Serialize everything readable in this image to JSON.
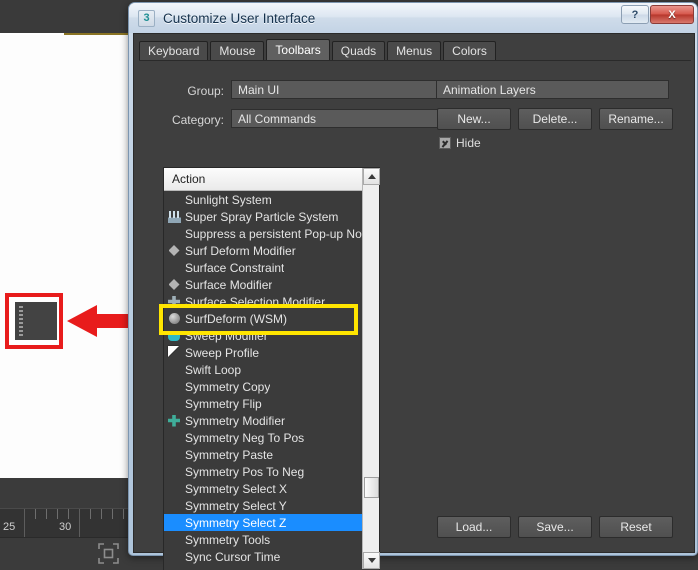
{
  "background_app": {
    "name": "3ds Max viewport",
    "timeline": {
      "labels": [
        {
          "text": "25",
          "x": 6
        },
        {
          "text": "30",
          "x": 62
        }
      ]
    },
    "select_icon": "select-object-icon"
  },
  "annotations": {
    "red_box": {
      "name": "red-highlight-box",
      "color": "#e81c1c"
    },
    "red_arrow": {
      "name": "red-arrow-pointer",
      "color": "#e81c1c"
    },
    "yellow_box": {
      "name": "yellow-highlight-box",
      "color": "#ffe500"
    }
  },
  "dialog": {
    "title": "Customize User Interface",
    "icon": "3ds-max-logo-icon",
    "window_buttons": {
      "help": "?",
      "close": "X"
    },
    "tabs": [
      {
        "label": "Keyboard",
        "active": false
      },
      {
        "label": "Mouse",
        "active": false
      },
      {
        "label": "Toolbars",
        "active": true
      },
      {
        "label": "Quads",
        "active": false
      },
      {
        "label": "Menus",
        "active": false
      },
      {
        "label": "Colors",
        "active": false
      }
    ],
    "fields": {
      "group_label": "Group:",
      "group_value": "Main UI",
      "category_label": "Category:",
      "category_value": "All Commands"
    },
    "list": {
      "header": "Action",
      "items": [
        {
          "label": "Sunlight System",
          "icon": "none",
          "selected": false
        },
        {
          "label": "Super Spray Particle System",
          "icon": "spray",
          "selected": false
        },
        {
          "label": "Suppress a persistent Pop-up Note",
          "icon": "none",
          "selected": false
        },
        {
          "label": "Surf Deform Modifier",
          "icon": "diamond",
          "selected": false
        },
        {
          "label": "Surface Constraint",
          "icon": "none",
          "selected": false
        },
        {
          "label": "Surface Modifier",
          "icon": "diamond",
          "selected": false
        },
        {
          "label": "Surface Selection Modifier",
          "icon": "cross-gray",
          "selected": false
        },
        {
          "label": "SurfDeform (WSM)",
          "icon": "sphere",
          "selected": false
        },
        {
          "label": "Sweep Modifier",
          "icon": "teal",
          "selected": false
        },
        {
          "label": "Sweep Profile",
          "icon": "cursor",
          "selected": false
        },
        {
          "label": "Swift Loop",
          "icon": "none",
          "selected": false
        },
        {
          "label": "Symmetry Copy",
          "icon": "none",
          "selected": false
        },
        {
          "label": "Symmetry Flip",
          "icon": "none",
          "selected": false
        },
        {
          "label": "Symmetry Modifier",
          "icon": "cross",
          "selected": false
        },
        {
          "label": "Symmetry Neg To Pos",
          "icon": "none",
          "selected": false
        },
        {
          "label": "Symmetry Paste",
          "icon": "none",
          "selected": false
        },
        {
          "label": "Symmetry Pos To Neg",
          "icon": "none",
          "selected": false
        },
        {
          "label": "Symmetry Select X",
          "icon": "none",
          "selected": false
        },
        {
          "label": "Symmetry Select Y",
          "icon": "none",
          "selected": false
        },
        {
          "label": "Symmetry Select Z",
          "icon": "none",
          "selected": true
        },
        {
          "label": "Symmetry Tools",
          "icon": "none",
          "selected": false
        },
        {
          "label": "Sync Cursor Time",
          "icon": "none",
          "selected": false
        }
      ]
    },
    "right_panel": {
      "toolbar_value": "Animation Layers",
      "new_label": "New...",
      "delete_label": "Delete...",
      "rename_label": "Rename...",
      "hide_label": "Hide",
      "hide_checked": true
    },
    "footer": {
      "load_label": "Load...",
      "save_label": "Save...",
      "reset_label": "Reset"
    }
  }
}
